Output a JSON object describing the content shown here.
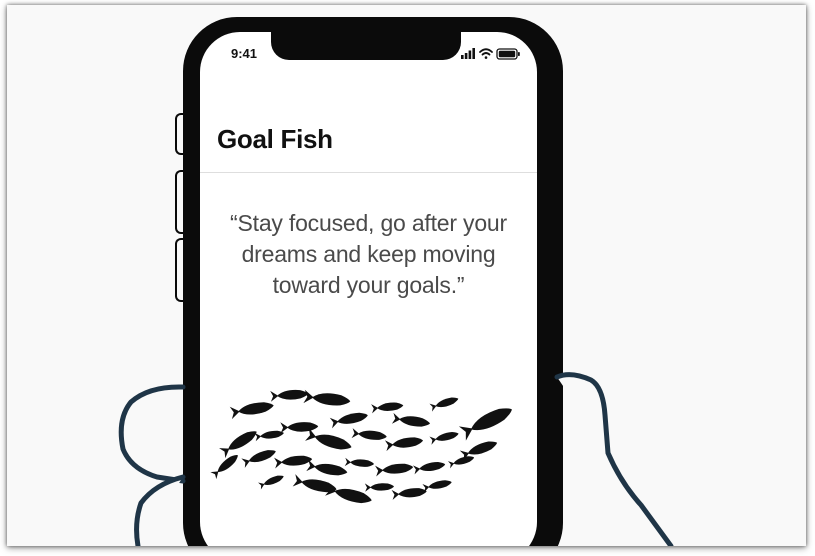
{
  "status_bar": {
    "time": "9:41"
  },
  "app": {
    "title": "Goal Fish"
  },
  "quote": {
    "line1": "“Stay focused, go after your",
    "line2": "dreams and keep moving",
    "line3": "toward your goals.”"
  },
  "colors": {
    "background": "#f9f9f9",
    "phone_body": "#0b0b0b",
    "screen": "#ffffff",
    "quote_text": "#4a4a4a",
    "hand_outline": "#1f3547"
  },
  "icons": [
    "signal-icon",
    "wifi-icon",
    "battery-icon"
  ]
}
